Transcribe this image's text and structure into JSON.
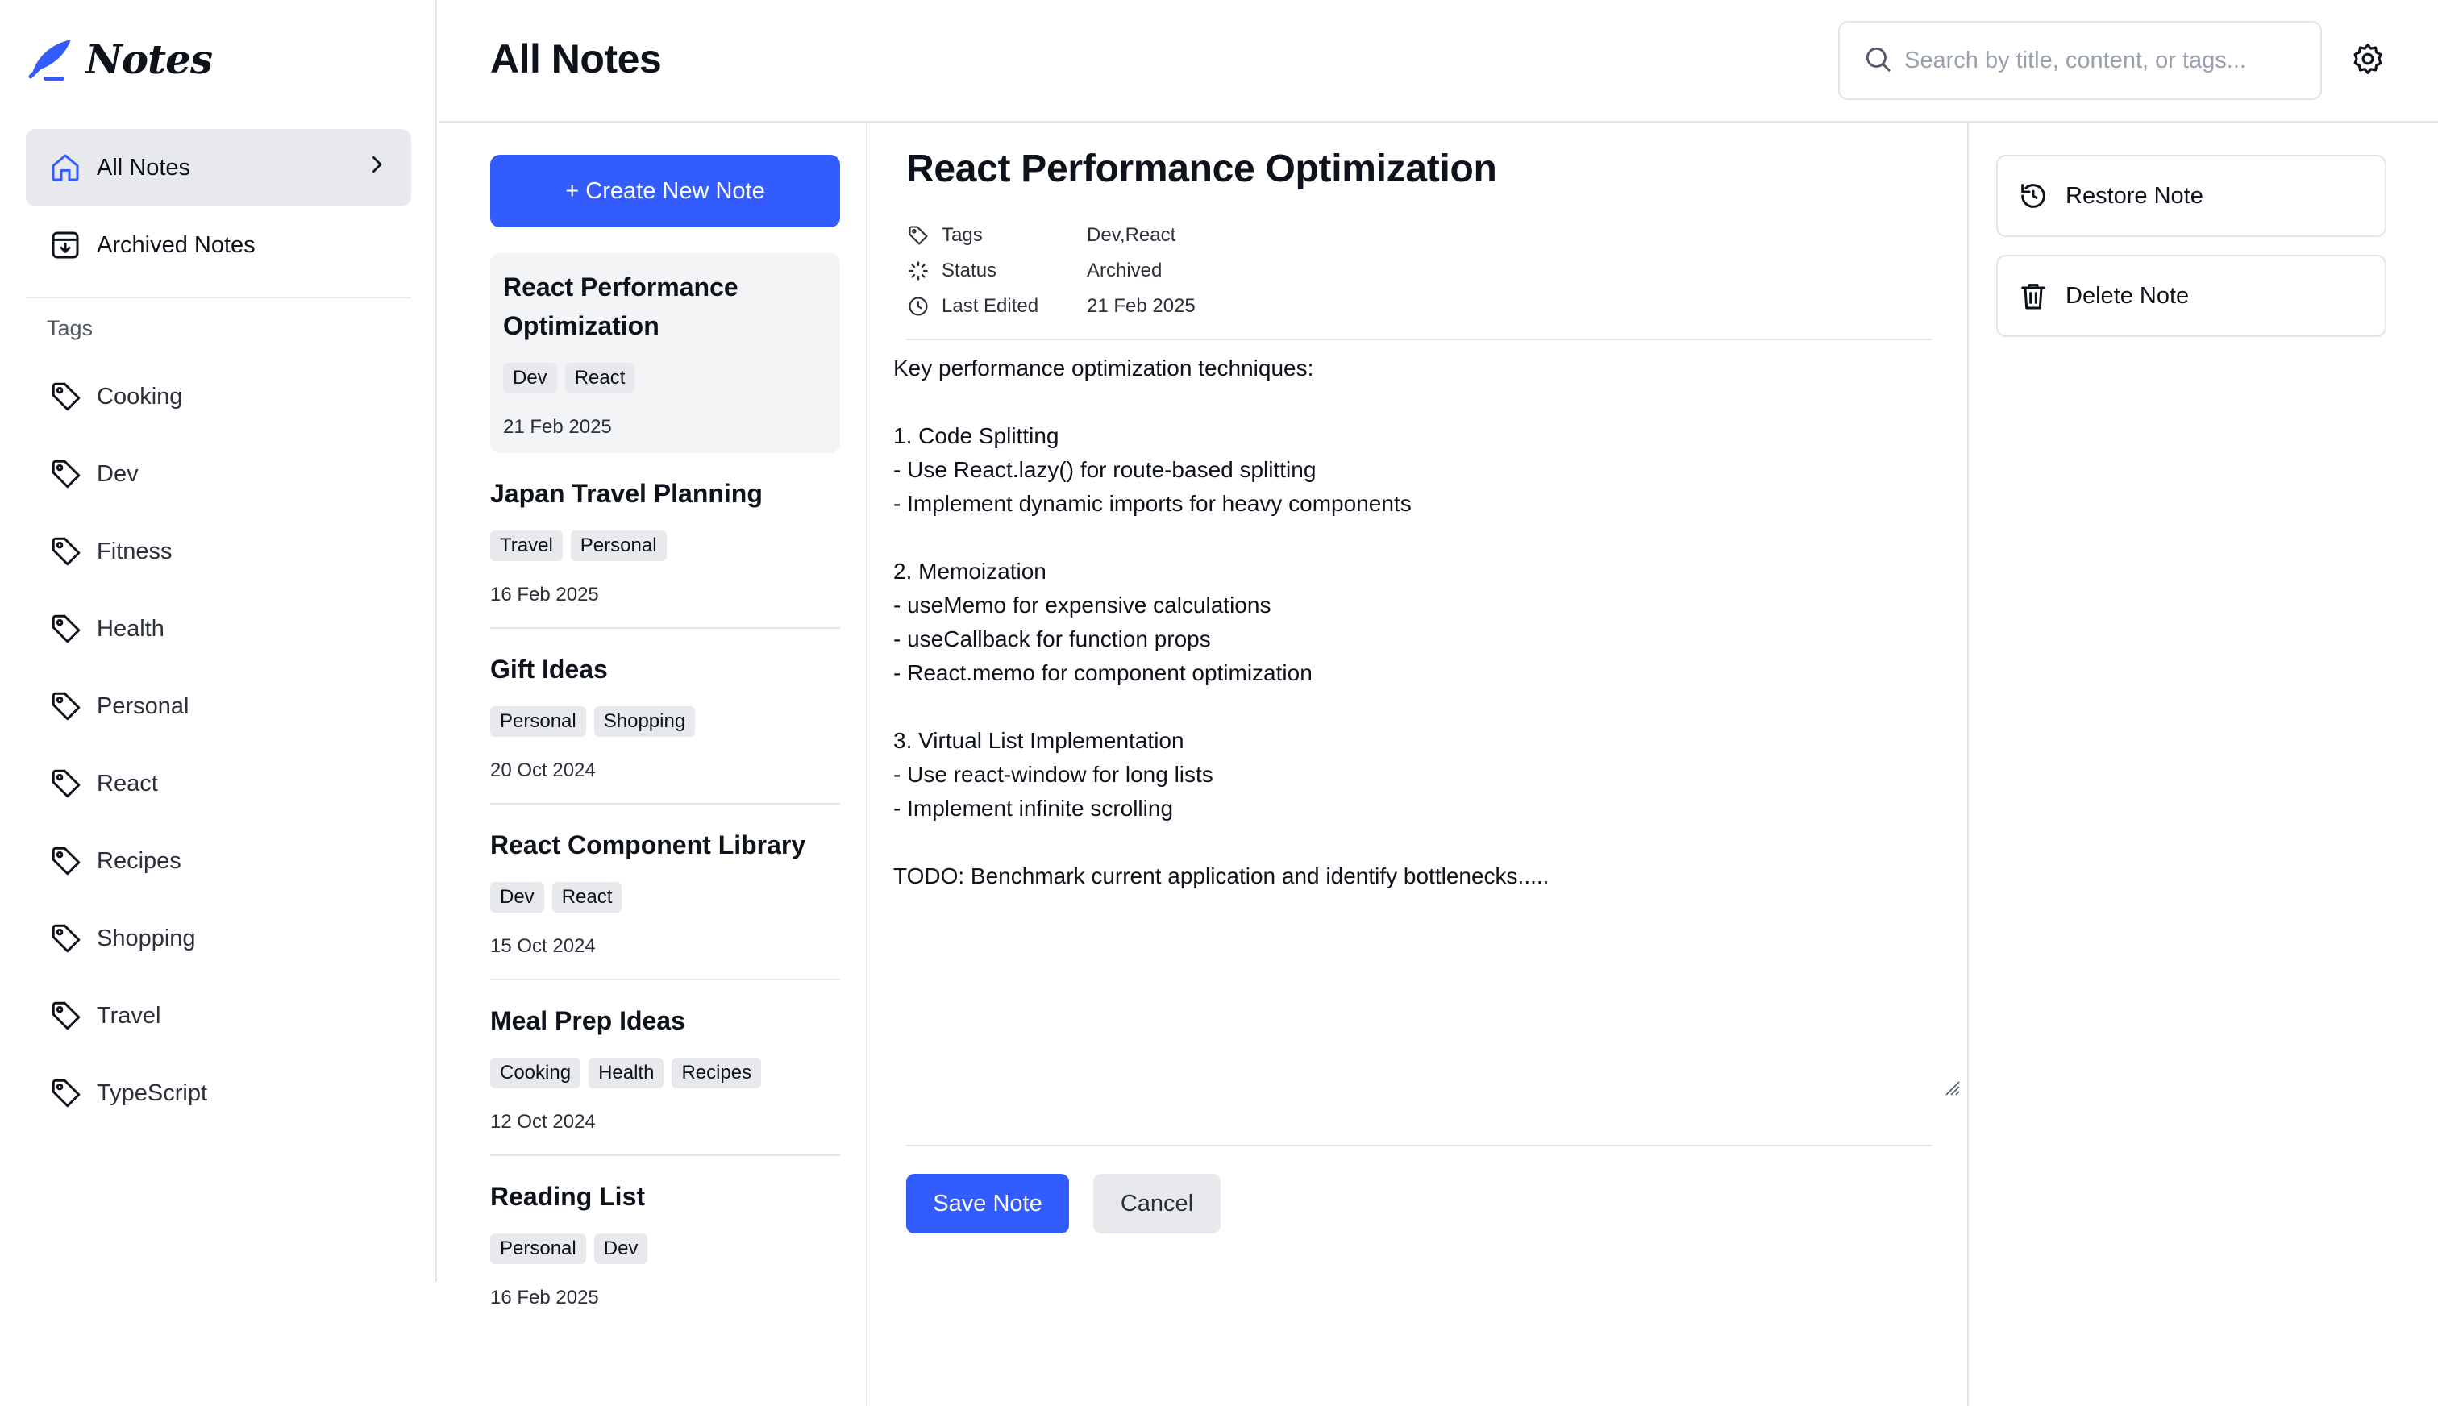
{
  "app": {
    "name": "Notes"
  },
  "sidebar": {
    "nav": [
      {
        "label": "All Notes",
        "icon": "home-icon",
        "active": true
      },
      {
        "label": "Archived Notes",
        "icon": "archive-icon",
        "active": false
      }
    ],
    "tags_heading": "Tags",
    "tags": [
      "Cooking",
      "Dev",
      "Fitness",
      "Health",
      "Personal",
      "React",
      "Recipes",
      "Shopping",
      "Travel",
      "TypeScript"
    ]
  },
  "header": {
    "title": "All Notes",
    "search_placeholder": "Search by title, content, or tags...",
    "settings_icon": "gear-icon"
  },
  "notes_list": {
    "create_label": "+ Create New Note",
    "notes": [
      {
        "title": "React Performance Optimization",
        "tags": [
          "Dev",
          "React"
        ],
        "date": "21 Feb 2025",
        "active": true
      },
      {
        "title": "Japan Travel Planning",
        "tags": [
          "Travel",
          "Personal"
        ],
        "date": "16 Feb 2025"
      },
      {
        "title": "Gift Ideas",
        "tags": [
          "Personal",
          "Shopping"
        ],
        "date": "20 Oct 2024"
      },
      {
        "title": "React Component Library",
        "tags": [
          "Dev",
          "React"
        ],
        "date": "15 Oct 2024"
      },
      {
        "title": "Meal Prep Ideas",
        "tags": [
          "Cooking",
          "Health",
          "Recipes"
        ],
        "date": "12 Oct 2024"
      },
      {
        "title": "Reading List",
        "tags": [
          "Personal",
          "Dev"
        ],
        "date": "16 Feb 2025"
      }
    ]
  },
  "editor": {
    "title": "React Performance Optimization",
    "meta": {
      "tags_label": "Tags",
      "tags_value": "Dev,React",
      "status_label": "Status",
      "status_value": "Archived",
      "edited_label": "Last Edited",
      "edited_value": "21 Feb 2025"
    },
    "body": "Key performance optimization techniques:\n\n1. Code Splitting\n- Use React.lazy() for route-based splitting\n- Implement dynamic imports for heavy components\n\n2. Memoization\n- useMemo for expensive calculations\n- useCallback for function props\n- React.memo for component optimization\n\n3. Virtual List Implementation\n- Use react-window for long lists\n- Implement infinite scrolling\n\nTODO: Benchmark current application and identify bottlenecks.....",
    "save_label": "Save Note",
    "cancel_label": "Cancel"
  },
  "actions": {
    "restore_label": "Restore Note",
    "delete_label": "Delete Note"
  },
  "colors": {
    "accent": "#335cff",
    "border": "#e0e4ea",
    "chip": "#e7e9ec"
  }
}
